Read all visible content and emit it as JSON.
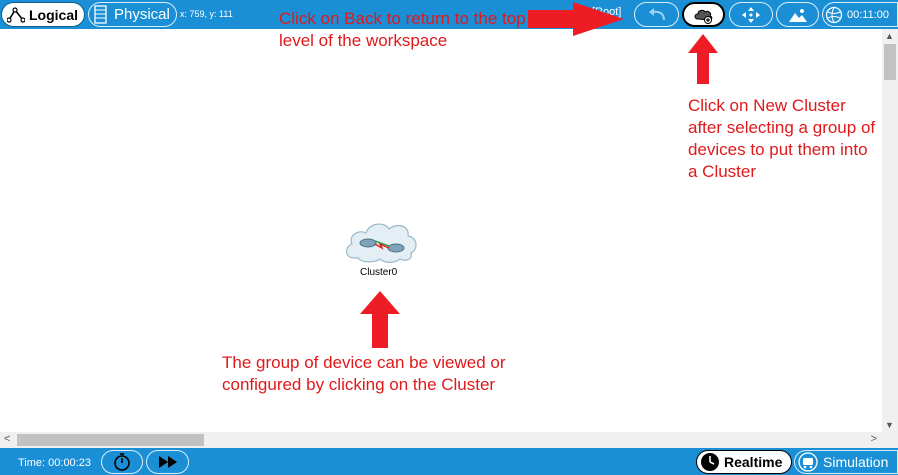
{
  "topbar": {
    "logical_label": "Logical",
    "physical_label": "Physical",
    "coords": "x: 759, y: 111",
    "root_label": "[Root]",
    "time_label": "00:11:00"
  },
  "annotations": {
    "back": "Click on Back to return to the top level of the workspace",
    "new_cluster": "Click on New Cluster after selecting a group of devices to put them into a Cluster",
    "group": "The group of device can be viewed or configured by clicking on the Cluster"
  },
  "workspace": {
    "cluster_label": "Cluster0"
  },
  "bottombar": {
    "time": "Time: 00:00:23",
    "realtime_label": "Realtime",
    "simulation_label": "Simulation"
  },
  "colors": {
    "bar": "#1a8fd6",
    "annotation": "#e0191b"
  },
  "icons": [
    "logical-icon",
    "physical-icon",
    "back-icon",
    "new-cluster-icon",
    "move-object-icon",
    "set-background-icon",
    "viewport-icon",
    "reset-time-icon",
    "fast-forward-icon",
    "realtime-clock-icon",
    "simulation-icon",
    "cluster-cloud-icon",
    "red-arrow-icon"
  ]
}
